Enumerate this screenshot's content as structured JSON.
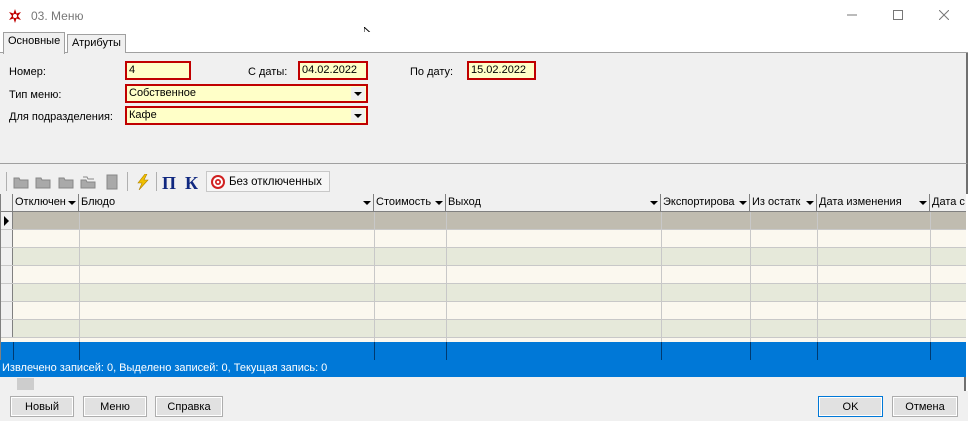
{
  "window": {
    "title": "03. Меню"
  },
  "tabs": [
    {
      "label": "Основные",
      "active": true
    },
    {
      "label": "Атрибуты",
      "active": false
    }
  ],
  "form": {
    "number_label": "Номер:",
    "number_value": "4",
    "date_from_label": "С даты:",
    "date_from_value": "04.02.2022",
    "date_to_label": "По дату:",
    "date_to_value": "15.02.2022",
    "menu_type_label": "Тип меню:",
    "menu_type_value": "Собственное",
    "department_label": "Для подразделения:",
    "department_value": "Кафе"
  },
  "toolbar": {
    "icons": [
      "folder-open-icon",
      "folder-icon",
      "folder-up-icon",
      "folders-icon",
      "document-icon",
      "lightning-icon",
      "pi-icon",
      "k-icon"
    ],
    "filter_button_label": "Без отключенных"
  },
  "grid": {
    "columns": [
      "Отключен",
      "Блюдо",
      "Стоимость",
      "Выход",
      "Экспортирова",
      "Из остатк",
      "Дата изменения",
      "Дата с"
    ],
    "rows": []
  },
  "status": {
    "text": "Извлечено записей: 0, Выделено записей: 0, Текущая запись: 0"
  },
  "buttons": {
    "new_label": "Новый",
    "menu_label": "Меню",
    "help_label": "Справка",
    "ok_label": "OK",
    "cancel_label": "Отмена"
  },
  "colors": {
    "required_border": "#c00000",
    "field_bg": "#ffffc8",
    "selection_blue": "#0078d7"
  }
}
